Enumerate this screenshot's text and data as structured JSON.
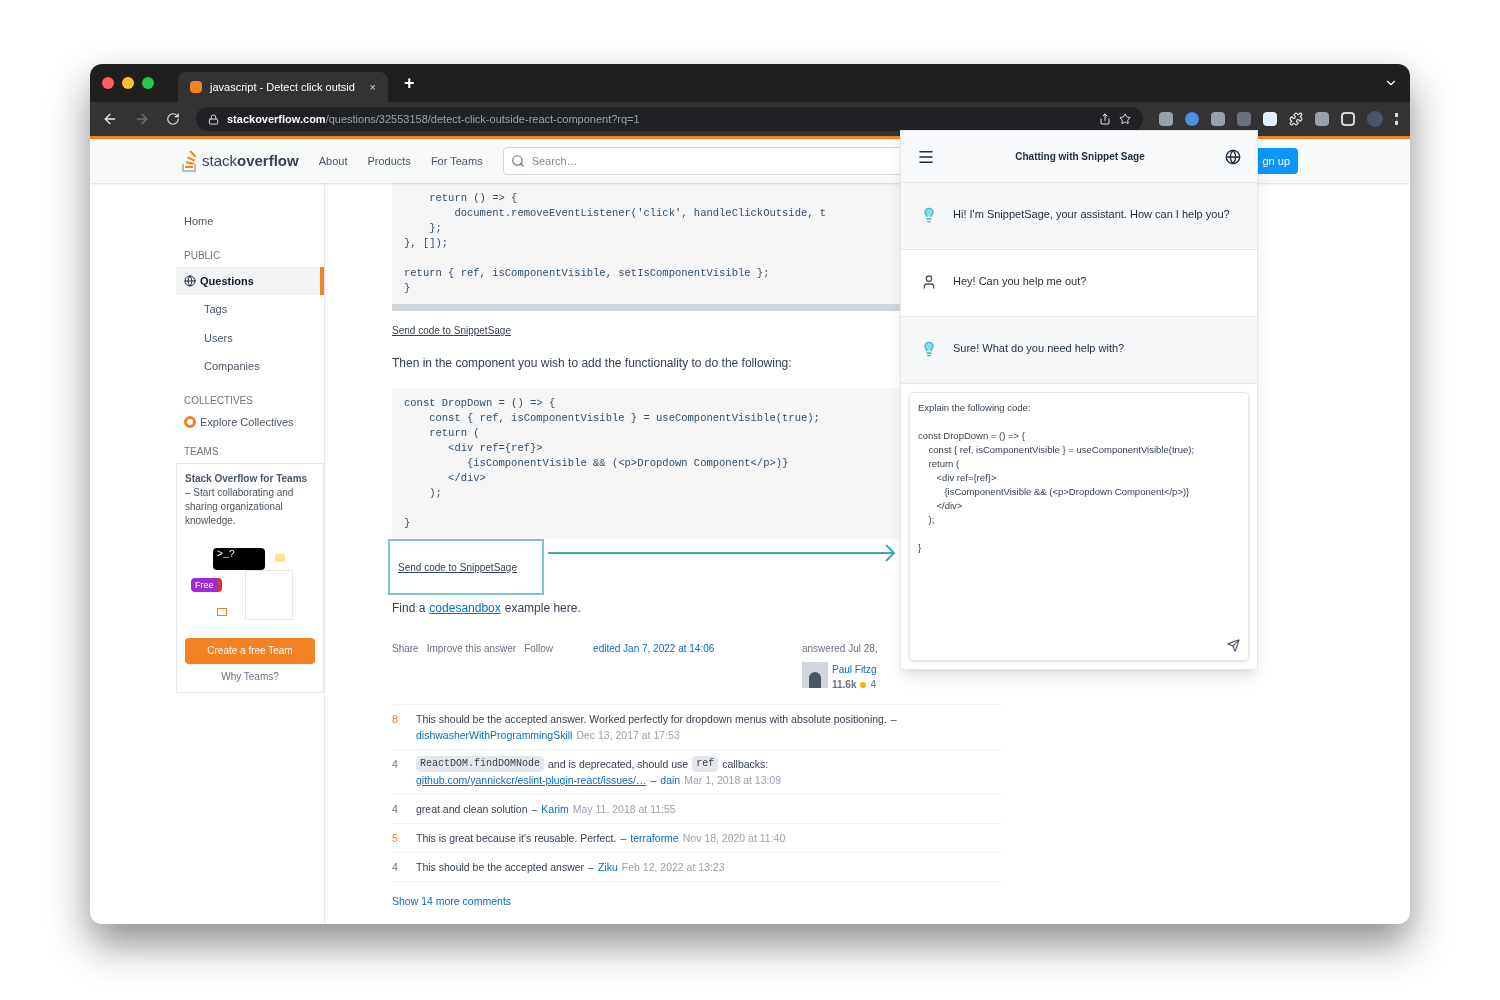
{
  "browser": {
    "tab_title": "javascript - Detect click outsid",
    "tab_close": "×",
    "new_tab": "+",
    "url_host": "stackoverflow.com",
    "url_path": "/questions/32553158/detect-click-outside-react-component?rq=1"
  },
  "site_header": {
    "logo_light": "stack",
    "logo_bold": "overflow",
    "nav": [
      "About",
      "Products",
      "For Teams"
    ],
    "search": {
      "placeholder": "Search…"
    },
    "signup": "gn up"
  },
  "sidebar": {
    "items": [
      {
        "kind": "link",
        "label": "Home",
        "selected": false
      },
      {
        "kind": "heading",
        "label": "PUBLIC"
      },
      {
        "kind": "main",
        "label": "Questions",
        "selected": true
      },
      {
        "kind": "sub",
        "label": "Tags",
        "selected": false
      },
      {
        "kind": "sub",
        "label": "Users",
        "selected": false
      },
      {
        "kind": "sub",
        "label": "Companies",
        "selected": false
      },
      {
        "kind": "heading",
        "label": "COLLECTIVES"
      },
      {
        "kind": "collective",
        "label": "Explore Collectives",
        "selected": false
      },
      {
        "kind": "heading",
        "label": "TEAMS"
      }
    ],
    "teams": {
      "text": "**Stack Overflow for Teams** – Start collaborating and sharing organizational knowledge.",
      "prompt": ">_?",
      "badge": "Free",
      "button": "Create a free Team",
      "why": "Why Teams?"
    }
  },
  "answer": {
    "code_1": "    return () => {\n        document.removeEventListener('click', handleClickOutside, t\n    };\n}, []);\n\nreturn { ref, isComponentVisible, setIsComponentVisible };\n}",
    "send_link_1": "Send code to SnippetSage",
    "paragraph": "Then in the component you wish to add the functionality to do the following:",
    "code_2": "const DropDown = () => {\n    const { ref, isComponentVisible } = useComponentVisible(true);\n    return (\n       <div ref={ref}>\n          {isComponentVisible && (<p>Dropdown Component</p>)}\n       </div>\n    );\n\n}",
    "send_link_2": "Send code to SnippetSage",
    "find_before": "Find a",
    "find_link": "codesandbox",
    "find_after": "example here.",
    "menu": [
      "Share",
      "Improve this answer",
      "Follow"
    ],
    "edited": "edited Jan 7, 2022 at 14:06",
    "answered": "answered Jul 28,",
    "user_name": "Paul Fitzg",
    "user_rep": "11.6k",
    "user_badge": "4"
  },
  "comments": [
    {
      "score": "8",
      "hot": true,
      "parts": [
        {
          "kind": "text",
          "text": "This should be the accepted answer. Worked perfectly for dropdown menus with absolute positioning."
        }
      ],
      "dash": "–",
      "author": "dishwasherWithProgrammingSkill",
      "date": "Dec 13, 2017 at 17:53"
    },
    {
      "score": "4",
      "hot": false,
      "parts": [
        {
          "kind": "code",
          "text": "ReactDOM.findDOMNode"
        },
        {
          "kind": "text",
          "text": "and is deprecated, should use"
        },
        {
          "kind": "code",
          "text": "ref"
        },
        {
          "kind": "text",
          "text": "callbacks:"
        },
        {
          "kind": "link",
          "text": "github.com/yannickcr/eslint-plugin-react/issues/…"
        }
      ],
      "dash": "–",
      "author": "dain",
      "date": "Mar 1, 2018 at 13:09"
    },
    {
      "score": "4",
      "hot": false,
      "parts": [
        {
          "kind": "text",
          "text": "great and clean solution"
        }
      ],
      "dash": "–",
      "author": "Karim",
      "date": "May 11, 2018 at 11:55"
    },
    {
      "score": "5",
      "hot": true,
      "parts": [
        {
          "kind": "text",
          "text": "This is great because it's reusable. Perfect."
        }
      ],
      "dash": "–",
      "author": "terraforme",
      "date": "Nov 18, 2020 at 11:40"
    },
    {
      "score": "4",
      "hot": false,
      "parts": [
        {
          "kind": "text",
          "text": "This should be the accepted answer"
        }
      ],
      "dash": "–",
      "author": "Ziku",
      "date": "Feb 12, 2022 at 13:23"
    }
  ],
  "more_comments": "Show 14 more comments",
  "chat": {
    "title": "Chatting with Snippet Sage",
    "messages": [
      {
        "kind": "bot",
        "text": "Hi! I'm SnippetSage, your assistant. How can I help you?"
      },
      {
        "kind": "user",
        "text": "Hey! Can you help me out?"
      },
      {
        "kind": "bot",
        "text": "Sure! What do you need help with?"
      }
    ],
    "input_value": "Explain the following code:\n\nconst DropDown = () => {\n    const { ref, isComponentVisible } = useComponentVisible(true);\n    return (\n       <div ref={ref}>\n          {isComponentVisible && (<p>Dropdown Component</p>)}\n       </div>\n    );\n\n}"
  }
}
